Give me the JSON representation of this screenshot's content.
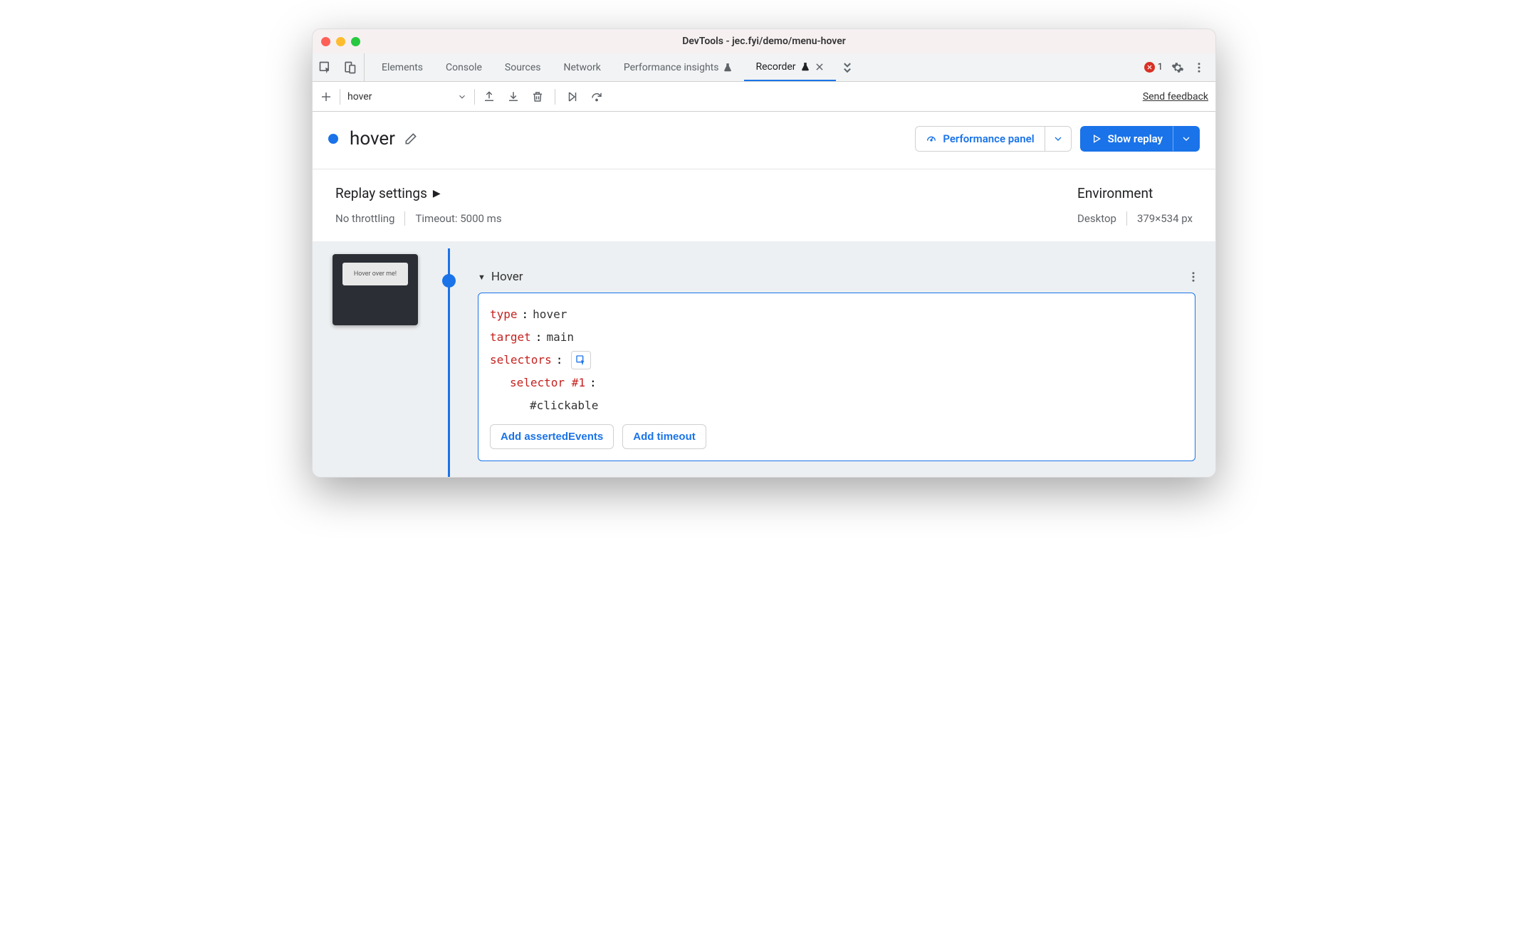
{
  "window": {
    "title": "DevTools - jec.fyi/demo/menu-hover"
  },
  "tabs": {
    "items": [
      {
        "label": "Elements"
      },
      {
        "label": "Console"
      },
      {
        "label": "Sources"
      },
      {
        "label": "Network"
      },
      {
        "label": "Performance insights",
        "beaker": true
      },
      {
        "label": "Recorder",
        "beaker": true,
        "active": true,
        "close": true
      }
    ],
    "error_count": "1"
  },
  "toolbar": {
    "recording_name": "hover",
    "feedback": "Send feedback"
  },
  "header": {
    "title": "hover",
    "perf_button": "Performance panel",
    "replay_button": "Slow replay"
  },
  "settings": {
    "heading": "Replay settings",
    "throttling": "No throttling",
    "timeout": "Timeout: 5000 ms",
    "env_heading": "Environment",
    "env_device": "Desktop",
    "env_size": "379×534 px"
  },
  "thumb_text": "Hover over me!",
  "step": {
    "title": "Hover",
    "lines": {
      "type_key": "type",
      "type_val": "hover",
      "target_key": "target",
      "target_val": "main",
      "selectors_key": "selectors",
      "selector1_key": "selector #1",
      "selector1_val": "#clickable"
    },
    "add_asserted": "Add assertedEvents",
    "add_timeout": "Add timeout"
  }
}
